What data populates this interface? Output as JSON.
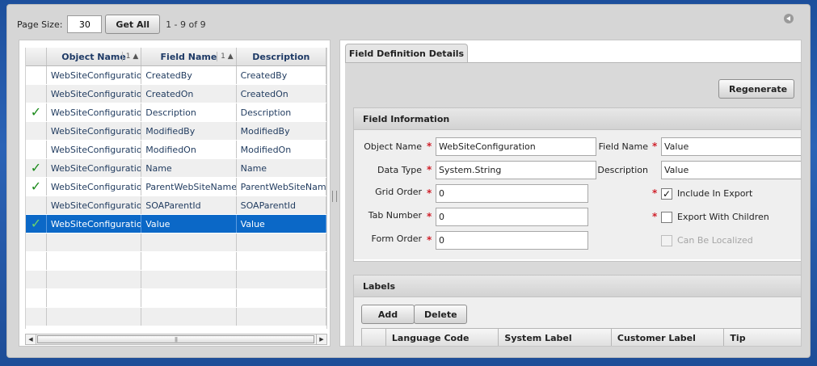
{
  "toolbar": {
    "page_size_label": "Page Size:",
    "page_size_value": "30",
    "get_all_label": "Get All",
    "record_count": "1 - 9 of 9"
  },
  "grid": {
    "columns": [
      {
        "label": "Object Name",
        "sort": "1"
      },
      {
        "label": "Field Name",
        "sort": "1"
      },
      {
        "label": "Description"
      }
    ],
    "rows": [
      {
        "checked": false,
        "object": "WebSiteConfiguration",
        "field": "CreatedBy",
        "description": "CreatedBy"
      },
      {
        "checked": false,
        "object": "WebSiteConfiguration",
        "field": "CreatedOn",
        "description": "CreatedOn"
      },
      {
        "checked": true,
        "object": "WebSiteConfiguration",
        "field": "Description",
        "description": "Description"
      },
      {
        "checked": false,
        "object": "WebSiteConfiguration",
        "field": "ModifiedBy",
        "description": "ModifiedBy"
      },
      {
        "checked": false,
        "object": "WebSiteConfiguration",
        "field": "ModifiedOn",
        "description": "ModifiedOn"
      },
      {
        "checked": true,
        "object": "WebSiteConfiguration",
        "field": "Name",
        "description": "Name"
      },
      {
        "checked": true,
        "object": "WebSiteConfiguration",
        "field": "ParentWebSiteName",
        "description": "ParentWebSiteName"
      },
      {
        "checked": false,
        "object": "WebSiteConfiguration",
        "field": "SOAParentId",
        "description": "SOAParentId"
      },
      {
        "checked": true,
        "object": "WebSiteConfiguration",
        "field": "Value",
        "description": "Value",
        "selected": true
      }
    ],
    "empty_rows": 5
  },
  "details": {
    "tab_label": "Field Definition Details",
    "regenerate_label": "Regenerate",
    "field_info": {
      "title": "Field Information",
      "object_name_label": "Object Name",
      "object_name_value": "WebSiteConfiguration",
      "data_type_label": "Data Type",
      "data_type_value": "System.String",
      "grid_order_label": "Grid Order",
      "grid_order_value": "0",
      "tab_number_label": "Tab Number",
      "tab_number_value": "0",
      "form_order_label": "Form Order",
      "form_order_value": "0",
      "field_name_label": "Field Name",
      "field_name_value": "Value",
      "description_label": "Description",
      "description_value": "Value",
      "include_export_label": "Include In Export",
      "include_export_checked": true,
      "export_children_label": "Export With Children",
      "export_children_checked": false,
      "localized_label": "Can Be Localized",
      "localized_checked": false
    },
    "labels": {
      "title": "Labels",
      "add_label": "Add",
      "delete_label": "Delete",
      "columns": [
        "Language Code",
        "System Label",
        "Customer Label",
        "Tip"
      ]
    }
  },
  "colors": {
    "selected_row": "#0b68c7",
    "check": "#1a8a1a",
    "required": "#d0202a",
    "background": "#1d4f9c"
  }
}
